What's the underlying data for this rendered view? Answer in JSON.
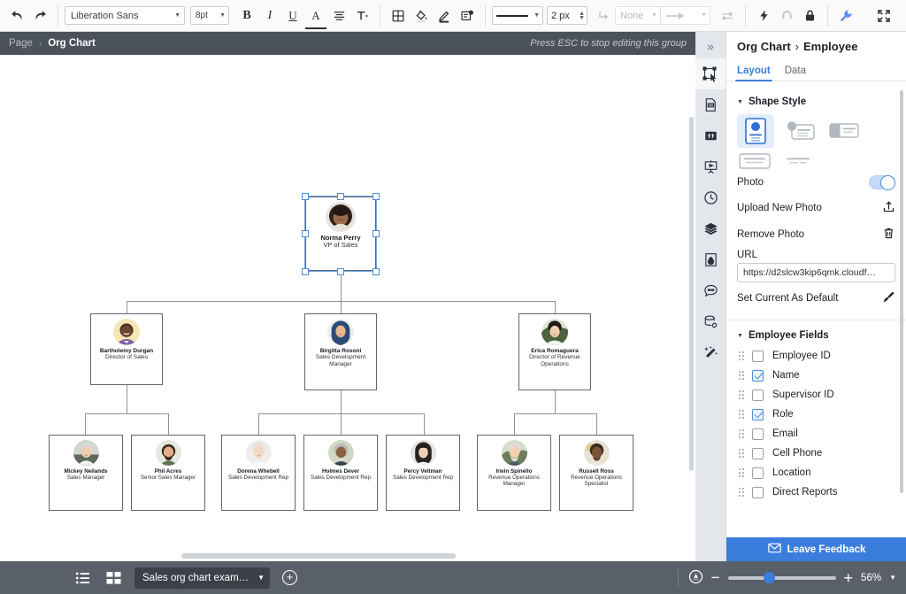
{
  "toolbar": {
    "undo_icon": "undo-icon",
    "redo_icon": "redo-icon",
    "font_family": "Liberation Sans",
    "font_size": "8pt",
    "bold_label": "B",
    "italic_label": "I",
    "underline_label": "U",
    "text_color_label": "A",
    "align_icon": "align-center-icon",
    "text_options_label": "T",
    "table_icon": "table-icon",
    "fill_icon": "fill-color-icon",
    "line_color_icon": "line-color-icon",
    "shape_options_icon": "shape-options-icon",
    "line_style_value": "",
    "line_width": "2 px",
    "connector_icon": "elbow-connector-icon",
    "start_arrow": "None",
    "end_arrow_icon": "arrow-end-icon",
    "swap_arrows_icon": "swap-arrows-icon",
    "lightning_icon": "lightning-icon",
    "magnet_icon": "magnet-icon",
    "lock_icon": "lock-icon",
    "wrench_icon": "wrench-icon",
    "fullscreen_icon": "fullscreen-icon"
  },
  "breadcrumb": {
    "root": "Page",
    "separator": "›",
    "current": "Org Chart",
    "hint": "Press ESC to stop editing this group"
  },
  "rail": {
    "collapse_icon": "chevron-double-right-icon",
    "items": [
      {
        "name": "select-tool",
        "icon": "select-cursor-icon",
        "active": true
      },
      {
        "name": "shapes-panel",
        "icon": "document-shapes-icon",
        "active": false
      },
      {
        "name": "text-panel",
        "icon": "quote-text-icon",
        "active": false
      },
      {
        "name": "present-panel",
        "icon": "presentation-icon",
        "active": false
      },
      {
        "name": "history-panel",
        "icon": "clock-history-icon",
        "active": false
      },
      {
        "name": "layers-panel",
        "icon": "layers-icon",
        "active": false
      },
      {
        "name": "theme-panel",
        "icon": "theme-droplet-icon",
        "active": false
      },
      {
        "name": "comments-panel",
        "icon": "comment-bubble-icon",
        "active": false
      },
      {
        "name": "data-panel",
        "icon": "database-link-icon",
        "active": false
      },
      {
        "name": "magic-panel",
        "icon": "magic-wand-icon",
        "active": false
      }
    ]
  },
  "panel": {
    "title_prefix": "Org Chart",
    "title_sep": "›",
    "title_current": "Employee",
    "tabs": [
      {
        "label": "Layout",
        "active": true
      },
      {
        "label": "Data",
        "active": false
      }
    ],
    "shape_style": {
      "heading": "Shape Style",
      "options": [
        {
          "name": "style-card-vertical-photo",
          "selected": true
        },
        {
          "name": "style-card-avatar-left",
          "selected": false
        },
        {
          "name": "style-card-block-left",
          "selected": false
        },
        {
          "name": "style-card-text-box",
          "selected": false
        },
        {
          "name": "style-card-text-lines",
          "selected": false
        }
      ],
      "photo_label": "Photo",
      "photo_enabled": true,
      "upload_label": "Upload New Photo",
      "upload_icon": "upload-icon",
      "remove_label": "Remove Photo",
      "remove_icon": "trash-icon",
      "url_label": "URL",
      "url_value": "https://d2slcw3kip6qmk.cloudf…",
      "set_default_label": "Set Current As Default",
      "set_default_icon": "paint-brush-icon"
    },
    "employee_fields": {
      "heading": "Employee Fields",
      "fields": [
        {
          "label": "Employee ID",
          "checked": false
        },
        {
          "label": "Name",
          "checked": true
        },
        {
          "label": "Supervisor ID",
          "checked": false
        },
        {
          "label": "Role",
          "checked": true
        },
        {
          "label": "Email",
          "checked": false
        },
        {
          "label": "Cell Phone",
          "checked": false
        },
        {
          "label": "Location",
          "checked": false
        },
        {
          "label": "Direct Reports",
          "checked": false
        }
      ]
    },
    "feedback_label": "Leave Feedback",
    "feedback_icon": "envelope-icon"
  },
  "bottom": {
    "list_view_icon": "list-view-icon",
    "grid_view_icon": "grid-view-icon",
    "page_tab_label": "Sales org chart exam…",
    "page_tab_caret": "▼",
    "add_page_icon": "plus-circle-icon",
    "fit_icon": "fit-to-screen-icon",
    "zoom_out_label": "−",
    "zoom_in_label": "+",
    "zoom_value": "56%",
    "zoom_caret": "▼"
  },
  "chart_data": {
    "type": "org-chart",
    "title": "Sales org chart example",
    "nodes": [
      {
        "id": "n1",
        "name": "Norma Perry",
        "role": "VP of Sales",
        "level": 1,
        "parent": null,
        "selected": true
      },
      {
        "id": "n2",
        "name": "Bartholemy Durgan",
        "role": "Director of Sales",
        "level": 2,
        "parent": "n1",
        "selected": false
      },
      {
        "id": "n3",
        "name": "Birgitta Rosoni",
        "role": "Sales Development Manager",
        "level": 2,
        "parent": "n1",
        "selected": false
      },
      {
        "id": "n4",
        "name": "Erica Romaguera",
        "role": "Director of Revenue Operations",
        "level": 2,
        "parent": "n1",
        "selected": false
      },
      {
        "id": "n5",
        "name": "Mickey Neilands",
        "role": "Sales Manager",
        "level": 3,
        "parent": "n2",
        "selected": false
      },
      {
        "id": "n6",
        "name": "Phil Acres",
        "role": "Senior Sales Manager",
        "level": 3,
        "parent": "n2",
        "selected": false
      },
      {
        "id": "n7",
        "name": "Dorena Whebell",
        "role": "Sales Development Rep",
        "level": 3,
        "parent": "n3",
        "selected": false
      },
      {
        "id": "n8",
        "name": "Holmes Dever",
        "role": "Sales Development Rep",
        "level": 3,
        "parent": "n3",
        "selected": false
      },
      {
        "id": "n9",
        "name": "Percy Veltman",
        "role": "Sales Development Rep",
        "level": 3,
        "parent": "n3",
        "selected": false
      },
      {
        "id": "n10",
        "name": "Irwin Spinello",
        "role": "Revenue Operations Manager",
        "level": 3,
        "parent": "n4",
        "selected": false
      },
      {
        "id": "n11",
        "name": "Russell Ross",
        "role": "Revenue Operations Specialist",
        "level": 3,
        "parent": "n4",
        "selected": false
      }
    ]
  }
}
